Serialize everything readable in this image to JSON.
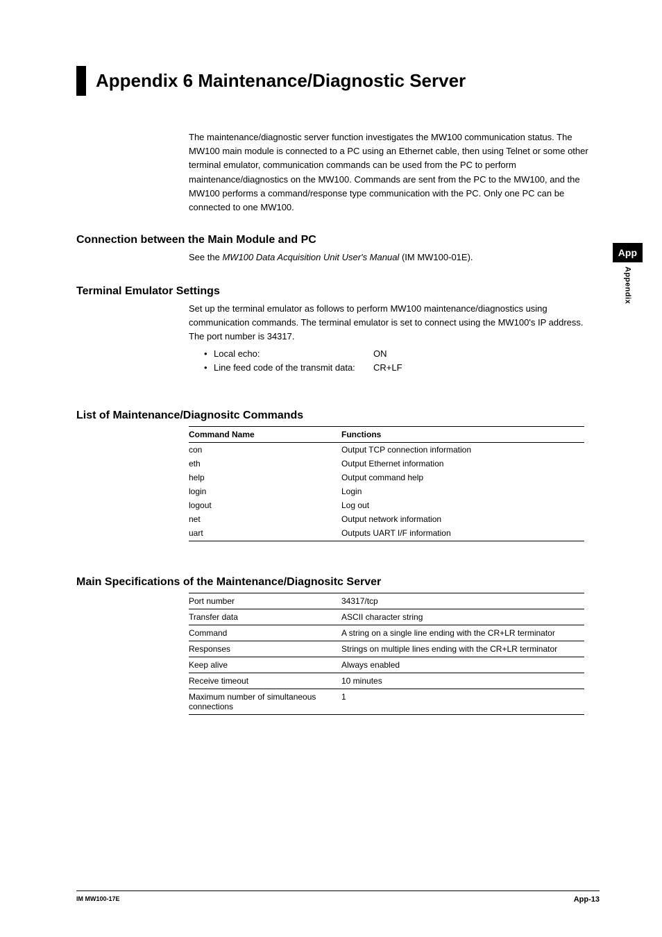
{
  "title": "Appendix 6   Maintenance/Diagnostic Server",
  "intro": "The maintenance/diagnostic server function investigates the MW100 communication status. The MW100 main module is connected to a PC using an Ethernet cable, then using Telnet or some other terminal emulator, communication commands can be used from the PC to perform maintenance/diagnostics on the MW100. Commands are sent from the PC to the MW100, and the MW100 performs a command/response type communication with the PC. Only one PC can be connected to one MW100.",
  "sections": {
    "connection": {
      "heading": "Connection between the Main Module and PC",
      "prefix": "See the ",
      "italic": "MW100 Data Acquisition Unit User's Manual",
      "suffix": " (IM MW100-01E)."
    },
    "terminal": {
      "heading": "Terminal Emulator Settings",
      "body": "Set up the terminal emulator as follows to perform MW100 maintenance/diagnostics using communication commands. The terminal emulator is set to connect using the MW100's IP address.  The port number is 34317.",
      "bullets": [
        {
          "label": "Local echo:",
          "value": "ON"
        },
        {
          "label": "Line feed code of the transmit data:",
          "value": "CR+LF"
        }
      ]
    },
    "commands": {
      "heading": "List of Maintenance/Diagnositc Commands",
      "head_name": "Command Name",
      "head_func": "Functions",
      "rows": [
        {
          "name": "con",
          "func": "Output TCP connection information"
        },
        {
          "name": "eth",
          "func": "Output Ethernet information"
        },
        {
          "name": "help",
          "func": "Output command help"
        },
        {
          "name": "login",
          "func": "Login"
        },
        {
          "name": "logout",
          "func": "Log out"
        },
        {
          "name": "net",
          "func": "Output network information"
        },
        {
          "name": "uart",
          "func": "Outputs UART I/F information"
        }
      ]
    },
    "specs": {
      "heading": "Main Specifications of the Maintenance/Diagnositc Server",
      "rows": [
        {
          "key": "Port number",
          "val": "34317/tcp"
        },
        {
          "key": "Transfer data",
          "val": "ASCII character string"
        },
        {
          "key": "Command",
          "val": "A string on a single line ending with the CR+LR terminator"
        },
        {
          "key": "Responses",
          "val": "Strings on multiple lines ending with the CR+LR terminator"
        },
        {
          "key": "Keep alive",
          "val": "Always enabled"
        },
        {
          "key": "Receive timeout",
          "val": "10 minutes"
        },
        {
          "key": "Maximum number of simultaneous connections",
          "val": "1"
        }
      ]
    }
  },
  "side_tab": {
    "box": "App",
    "vertical": "Appendix"
  },
  "footer": {
    "left": "IM MW100-17E",
    "right": "App-13"
  }
}
